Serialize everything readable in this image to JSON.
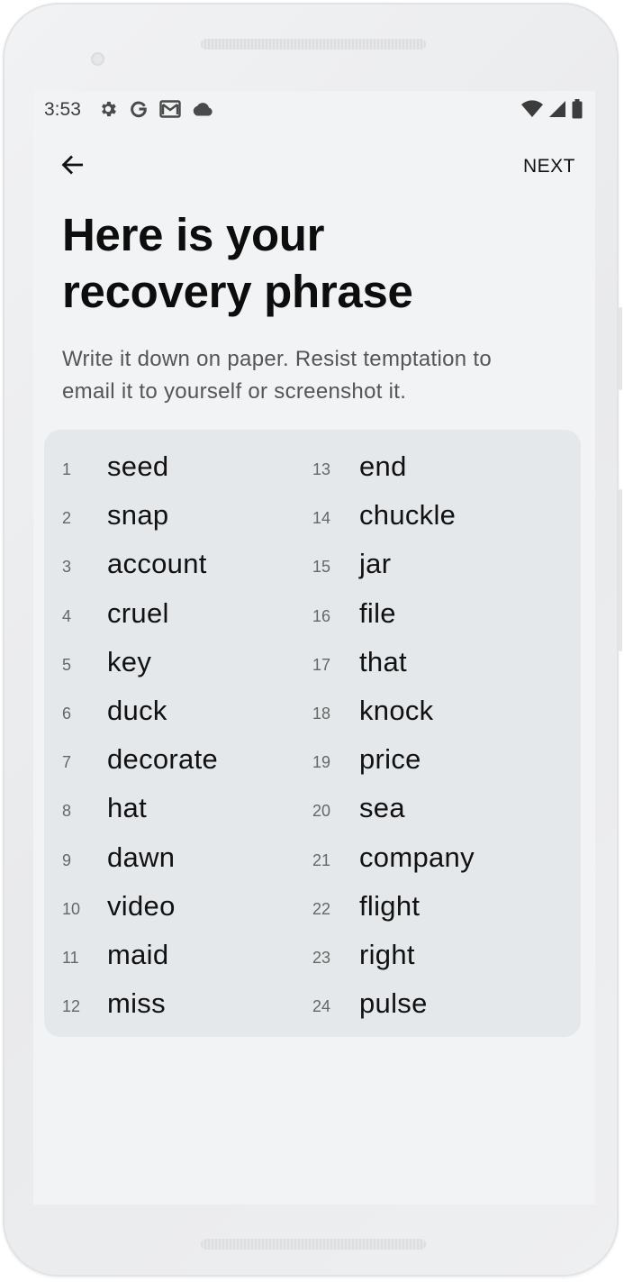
{
  "status_bar": {
    "time": "3:53",
    "left_icons": [
      "settings-icon",
      "google-icon",
      "gmail-icon",
      "cloud-icon"
    ],
    "right_icons": [
      "wifi-icon",
      "signal-icon",
      "battery-icon"
    ]
  },
  "header": {
    "back_icon": "arrow-left-icon",
    "next_label": "NEXT"
  },
  "title_line1": "Here is your",
  "title_line2": "recovery phrase",
  "instructions_line1": "Write it down on paper. Resist temptation to",
  "instructions_line2": "email it to yourself or screenshot it.",
  "phrase": {
    "left": [
      {
        "num": "1",
        "word": "seed"
      },
      {
        "num": "2",
        "word": "snap"
      },
      {
        "num": "3",
        "word": "account"
      },
      {
        "num": "4",
        "word": "cruel"
      },
      {
        "num": "5",
        "word": "key"
      },
      {
        "num": "6",
        "word": "duck"
      },
      {
        "num": "7",
        "word": "decorate"
      },
      {
        "num": "8",
        "word": "hat"
      },
      {
        "num": "9",
        "word": "dawn"
      },
      {
        "num": "10",
        "word": "video"
      },
      {
        "num": "11",
        "word": "maid"
      },
      {
        "num": "12",
        "word": "miss"
      }
    ],
    "right": [
      {
        "num": "13",
        "word": "end"
      },
      {
        "num": "14",
        "word": "chuckle"
      },
      {
        "num": "15",
        "word": "jar"
      },
      {
        "num": "16",
        "word": "file"
      },
      {
        "num": "17",
        "word": "that"
      },
      {
        "num": "18",
        "word": "knock"
      },
      {
        "num": "19",
        "word": "price"
      },
      {
        "num": "20",
        "word": "sea"
      },
      {
        "num": "21",
        "word": "company"
      },
      {
        "num": "22",
        "word": "flight"
      },
      {
        "num": "23",
        "word": "right"
      },
      {
        "num": "24",
        "word": "pulse"
      }
    ]
  },
  "colors": {
    "screen_bg": "#f2f3f5",
    "card_bg": "#e5e8eb",
    "title": "#0d0d0d",
    "body_text": "#555555"
  }
}
